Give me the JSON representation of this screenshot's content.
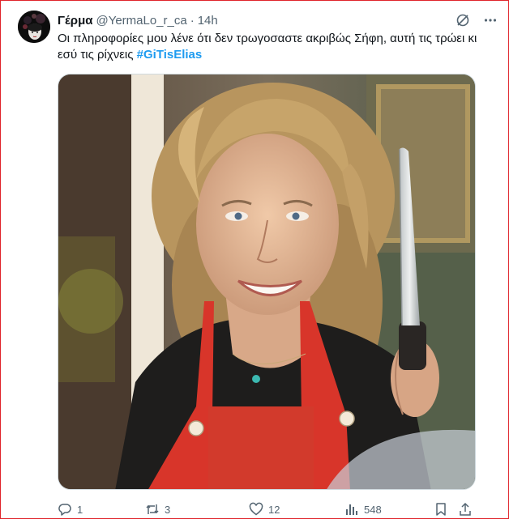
{
  "tweet": {
    "display_name": "Γέρμα",
    "handle": "@YermaLo_r_ca",
    "separator": "·",
    "time": "14h",
    "text": "Οι πληροφορίες μου λένε ότι δεν τρωγοσαστε ακριβώς Σήφη, αυτή τις τρώει κι εσύ τις ρίχνεις",
    "hashtag": "#GiTisElias",
    "hashtag_color": "#1d9bf0"
  },
  "header_icons": [
    "grok-icon",
    "more-icon"
  ],
  "media": {
    "alt": "",
    "subject_icons": [
      "woman-with-knife-photo"
    ]
  },
  "actions": {
    "replies": "1",
    "reposts": "3",
    "likes": "12",
    "views": "548"
  },
  "colors": {
    "frame_border": "#e0242a",
    "text_primary": "#0f1419",
    "text_secondary": "#536471",
    "apron": "#d8352a"
  }
}
